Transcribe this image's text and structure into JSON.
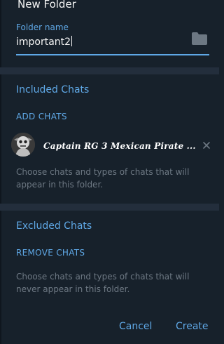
{
  "dialog": {
    "title": "New Folder"
  },
  "folder_name": {
    "label": "Folder name",
    "value": "important2"
  },
  "included": {
    "title": "Included Chats",
    "add_label": "ADD CHATS",
    "chats": [
      {
        "name": "Captain RG 3 Mexican Pirate ..."
      }
    ],
    "hint": "Choose chats and types of chats that will appear in this folder."
  },
  "excluded": {
    "title": "Excluded Chats",
    "remove_label": "REMOVE CHATS",
    "hint": "Choose chats and types of chats that will never appear in this folder."
  },
  "buttons": {
    "cancel": "Cancel",
    "create": "Create"
  },
  "colors": {
    "accent": "#5fa8e6",
    "background": "#17212b",
    "divider": "#232e3c",
    "hint": "#6d7883"
  },
  "icons": {
    "folder": "folder-icon",
    "remove": "close-icon"
  }
}
